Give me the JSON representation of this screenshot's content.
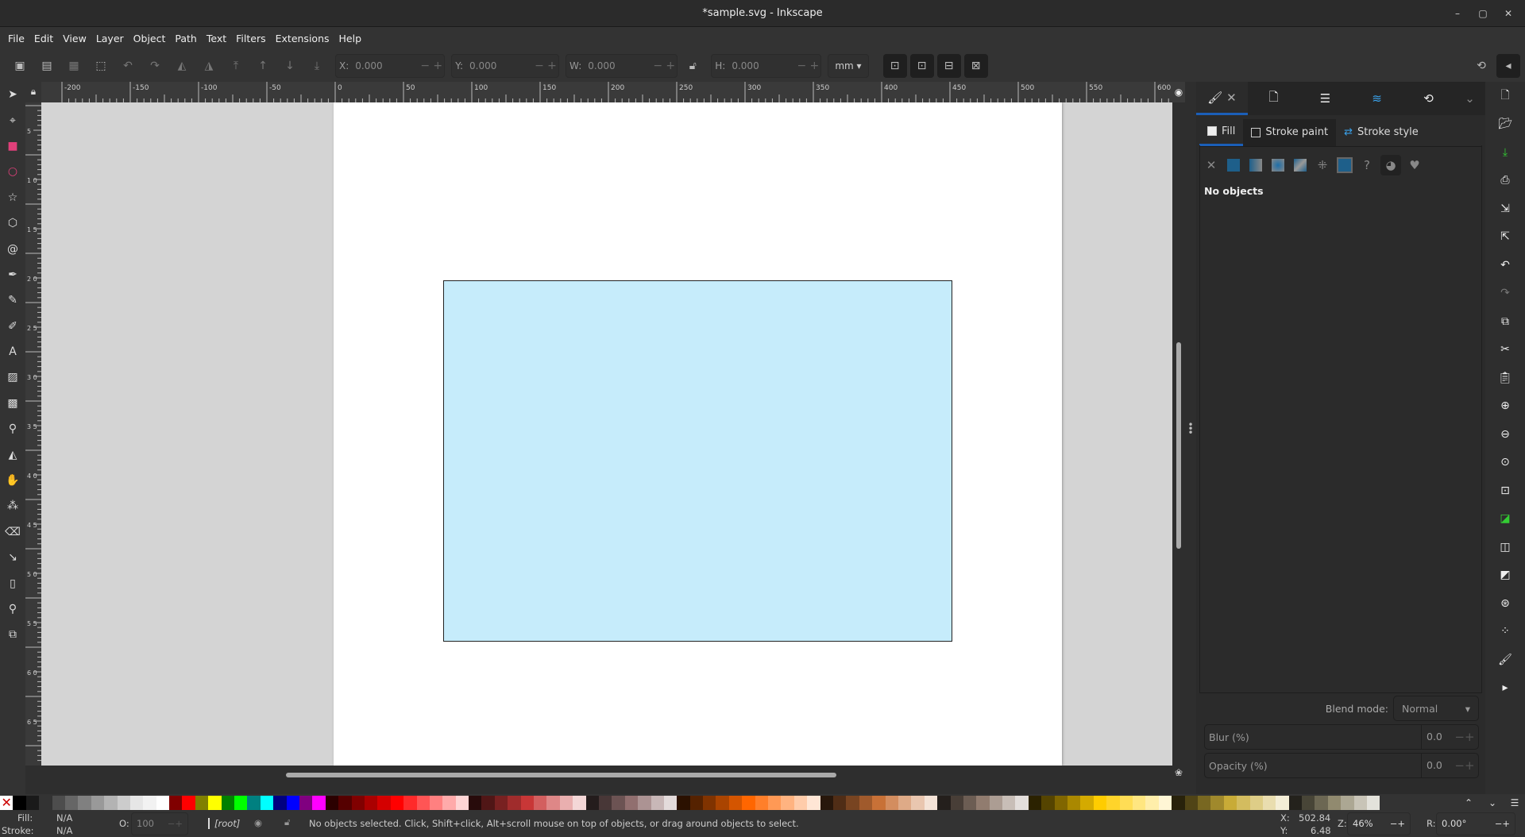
{
  "window": {
    "title": "*sample.svg - Inkscape",
    "controls": [
      "–",
      "▢",
      "✕"
    ]
  },
  "menu": [
    "File",
    "Edit",
    "View",
    "Layer",
    "Object",
    "Path",
    "Text",
    "Filters",
    "Extensions",
    "Help"
  ],
  "toolbar": {
    "x_label": "X:",
    "x": "0.000",
    "y_label": "Y:",
    "y": "0.000",
    "w_label": "W:",
    "w": "0.000",
    "h_label": "H:",
    "h": "0.000",
    "unit": "mm"
  },
  "ruler": {
    "labels": [
      "-200",
      "-150",
      "-100",
      "-50",
      "0",
      "50",
      "100",
      "150",
      "200",
      "250",
      "300",
      "350",
      "400",
      "450",
      "500",
      "550",
      "600"
    ],
    "vlabels": [
      "5",
      "1 0",
      "1 5",
      "2 0",
      "2 5",
      "3 0",
      "3 5",
      "4 0",
      "4 5",
      "5 0",
      "5 5",
      "6 0",
      "6 5"
    ]
  },
  "canvas": {
    "rect_fill": "#c6ecfb",
    "rect_stroke": "#222222",
    "page_color": "#ffffff",
    "desk_color": "#d4d4d4"
  },
  "panel": {
    "subtabs": {
      "fill": "Fill",
      "stroke_paint": "Stroke paint",
      "stroke_style": "Stroke style"
    },
    "no_objects": "No objects",
    "blend_label": "Blend mode:",
    "blend_value": "Normal",
    "blur_label": "Blur (%)",
    "blur_value": "0.0",
    "opacity_label": "Opacity (%)",
    "opacity_value": "0.0"
  },
  "palette": [
    "#000000",
    "#1a1a1a",
    "#333333",
    "#4d4d4d",
    "#666666",
    "#808080",
    "#999999",
    "#b3b3b3",
    "#cccccc",
    "#e6e6e6",
    "#f2f2f2",
    "#ffffff",
    "#800000",
    "#ff0000",
    "#808000",
    "#ffff00",
    "#008000",
    "#00ff00",
    "#008080",
    "#00ffff",
    "#000080",
    "#0000ff",
    "#800080",
    "#ff00ff",
    "#2b0000",
    "#550000",
    "#800000",
    "#aa0000",
    "#d40000",
    "#ff0000",
    "#ff2a2a",
    "#ff5555",
    "#ff8080",
    "#ffaaaa",
    "#ffd5d5",
    "#280b0b",
    "#501616",
    "#782121",
    "#a02c2c",
    "#c83737",
    "#d35f5f",
    "#de8787",
    "#e9afaf",
    "#f4d7d7",
    "#241c1c",
    "#483737",
    "#6c5353",
    "#916f6f",
    "#ac9393",
    "#c8b7b7",
    "#e3dbdb",
    "#2b1100",
    "#552200",
    "#803300",
    "#aa4400",
    "#d45500",
    "#ff6600",
    "#ff7f2a",
    "#ff9955",
    "#ffb380",
    "#ffccaa",
    "#ffe6d5",
    "#28170b",
    "#502d16",
    "#784421",
    "#a05a2c",
    "#c87137",
    "#d38d5f",
    "#deaa87",
    "#e9c6af",
    "#f4e3d7",
    "#241f1c",
    "#483e37",
    "#6c5d53",
    "#917c6f",
    "#ac9d93",
    "#c8beb7",
    "#e3dedb",
    "#2b2200",
    "#554400",
    "#806600",
    "#aa8800",
    "#d4aa00",
    "#ffcc00",
    "#ffd42a",
    "#ffdd55",
    "#ffe680",
    "#ffeeaa",
    "#fff6d5",
    "#28220b",
    "#504416",
    "#786721",
    "#a0892c",
    "#c8ab37",
    "#d3bc5f",
    "#decd87",
    "#e9ddaf",
    "#f4eed7",
    "#24221c",
    "#484537",
    "#6c6753",
    "#918a6f",
    "#aca793",
    "#c8c4b7",
    "#e3e2db"
  ],
  "status": {
    "fill_label": "Fill:",
    "fill": "N/A",
    "stroke_label": "Stroke:",
    "stroke": "N/A",
    "opacity_label": "O:",
    "opacity": "100",
    "layer": "[root]",
    "message": "No objects selected. Click, Shift+click, Alt+scroll mouse on top of objects, or drag around objects to select.",
    "x_label": "X:",
    "x": "502.84",
    "y_label": "Y:",
    "y": "6.48",
    "zoom_label": "Z:",
    "zoom": "46%",
    "rotate_label": "R:",
    "rotate": "0.00°"
  }
}
